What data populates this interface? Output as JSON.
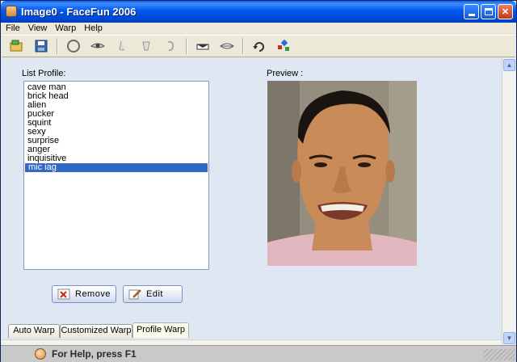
{
  "window": {
    "title": "Image0 - FaceFun 2006"
  },
  "menubar": {
    "items": [
      "File",
      "View",
      "Warp",
      "Help"
    ]
  },
  "toolbar": {
    "tools": [
      {
        "icon": "open-file-icon",
        "color": "#3a7a3a"
      },
      {
        "icon": "save-file-icon",
        "color": "#3a6ab0"
      },
      {
        "icon": "face-outline-icon",
        "color": "#7a7a7a"
      },
      {
        "icon": "eye-icon",
        "color": "#6a6a6a"
      },
      {
        "icon": "nose-icon",
        "color": "#9a9a9a"
      },
      {
        "icon": "cup-icon",
        "color": "#9a9a9a"
      },
      {
        "icon": "ear-icon",
        "color": "#a0a0a0"
      },
      {
        "icon": "mouth-icon",
        "color": "#5a5a5a"
      },
      {
        "icon": "lips-icon",
        "color": "#6a6a6a"
      },
      {
        "icon": "rotate-icon",
        "color": "#3a3a3a"
      },
      {
        "icon": "color-dots-icon",
        "color": "#2a6ad0"
      }
    ]
  },
  "profiles": {
    "label": "List Profile:",
    "items": [
      "cave man",
      "brick head",
      "alien",
      "pucker",
      "squint",
      "sexy",
      "surprise",
      "anger",
      "inquisitive",
      "mic iag"
    ],
    "selected_index": 9
  },
  "preview": {
    "label": "Preview :"
  },
  "actions": {
    "remove_label": "Remove",
    "edit_label": "Edit"
  },
  "tabs": {
    "items": [
      "Auto Warp",
      "Customized Warp",
      "Profile Warp"
    ],
    "active": "Profile Warp"
  },
  "statusbar": {
    "text": "For Help, press F1"
  }
}
